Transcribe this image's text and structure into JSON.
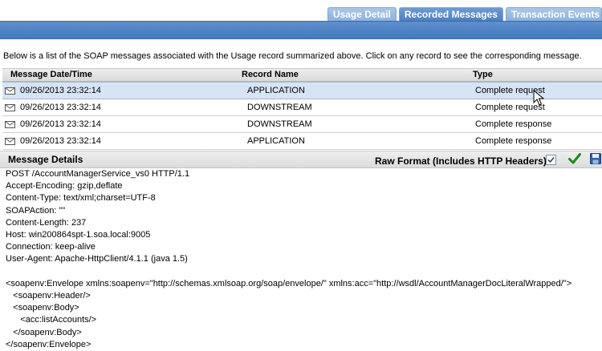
{
  "tabs": [
    {
      "label": "Usage Detail",
      "active": false
    },
    {
      "label": "Recorded Messages",
      "active": true
    },
    {
      "label": "Transaction Events",
      "active": false
    }
  ],
  "intro": "Below is a list of the SOAP messages associated with the Usage record summarized above. Click on any record to see the corresponding message.",
  "table": {
    "headers": [
      "Message Date/Time",
      "Record Name",
      "Type"
    ],
    "rows": [
      {
        "datetime": "09/26/2013 23:32:14",
        "record": "APPLICATION",
        "type": "Complete request",
        "selected": true
      },
      {
        "datetime": "09/26/2013 23:32:14",
        "record": "DOWNSTREAM",
        "type": "Complete request",
        "selected": false
      },
      {
        "datetime": "09/26/2013 23:32:14",
        "record": "DOWNSTREAM",
        "type": "Complete response",
        "selected": false
      },
      {
        "datetime": "09/26/2013 23:32:14",
        "record": "APPLICATION",
        "type": "Complete response",
        "selected": false
      }
    ]
  },
  "details": {
    "title": "Message Details",
    "raw_format_label": "Raw Format (Includes HTTP Headers):",
    "raw_format_checked": true,
    "confirm_icon": "checkmark-icon",
    "save_icon": "floppy-disk-icon"
  },
  "message_lines": [
    "POST /AccountManagerService_vs0 HTTP/1.1",
    "Accept-Encoding: gzip,deflate",
    "Content-Type: text/xml;charset=UTF-8",
    "SOAPAction: \"\"",
    "Content-Length: 237",
    "Host: win200864spt-1.soa.local:9005",
    "Connection: keep-alive",
    "User-Agent: Apache-HttpClient/4.1.1 (java 1.5)",
    "",
    "<soapenv:Envelope xmlns:soapenv=\"http://schemas.xmlsoap.org/soap/envelope/\" xmlns:acc=\"http://wsdl/AccountManagerDocLiteralWrapped/\">",
    "   <soapenv:Header/>",
    "   <soapenv:Body>",
    "      <acc:listAccounts/>",
    "   </soapenv:Body>",
    "</soapenv:Envelope>"
  ],
  "colors": {
    "accent": "#4a7dc0",
    "selected_row": "#d6e4f4",
    "check_green": "#1d8a1d"
  }
}
